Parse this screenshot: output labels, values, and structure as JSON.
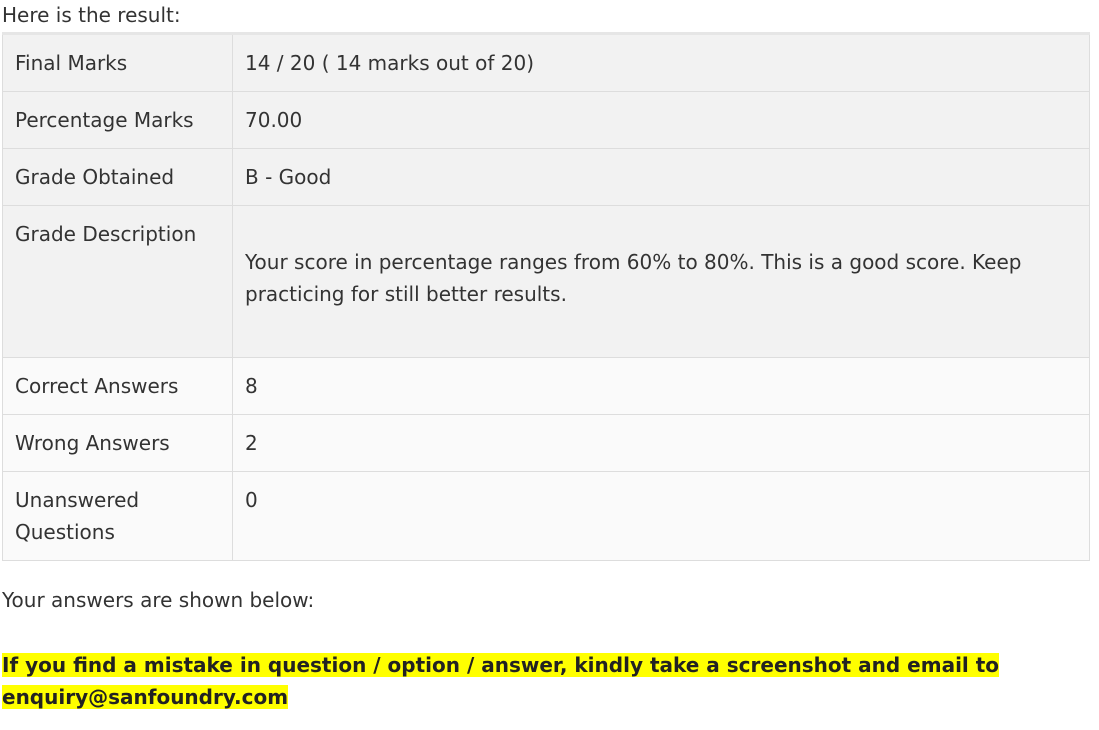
{
  "intro_text": "Here is the result:",
  "results": [
    {
      "label": "Final Marks",
      "value": "14 / 20 ( 14 marks out of 20)"
    },
    {
      "label": "Percentage Marks",
      "value": "70.00"
    },
    {
      "label": "Grade Obtained",
      "value": "B - Good"
    },
    {
      "label": "Grade Description",
      "value": "Your score in percentage ranges from 60% to 80%. This is a good score. Keep practicing for still better results."
    },
    {
      "label": "Correct Answers",
      "value": "8"
    },
    {
      "label": "Wrong Answers",
      "value": "2"
    },
    {
      "label": "Unanswered Questions",
      "value": "0"
    }
  ],
  "outro_text": "Your answers are shown below:",
  "notice": {
    "text": "If you find a mistake in question / option / answer, kindly take a screenshot and email to enquiry@sanfoundry.com",
    "highlight_color": "#ffff00"
  }
}
